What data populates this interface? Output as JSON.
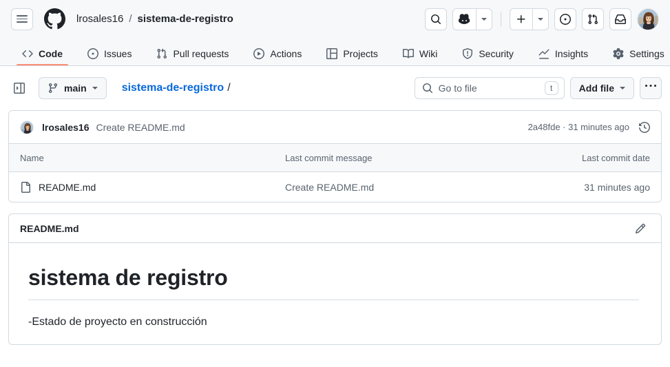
{
  "header": {
    "hamburger_icon": "hamburger-menu-icon",
    "logo_icon": "github-logo-icon",
    "breadcrumb": {
      "owner": "lrosales16",
      "separator": "/",
      "repo": "sistema-de-registro"
    },
    "actions": {
      "search_icon": "search-icon",
      "copilot_icon": "copilot-icon",
      "copilot_caret_icon": "chevron-down-icon",
      "plus_icon": "plus-icon",
      "plus_caret_icon": "chevron-down-icon",
      "issues_icon": "issue-opened-icon",
      "pull_requests_icon": "git-pull-request-icon",
      "inbox_icon": "inbox-icon",
      "avatar_icon": "user-avatar"
    }
  },
  "repo_nav": {
    "tabs": [
      {
        "label": "Code",
        "icon": "code-icon",
        "active": true
      },
      {
        "label": "Issues",
        "icon": "issue-opened-icon",
        "active": false
      },
      {
        "label": "Pull requests",
        "icon": "git-pull-request-icon",
        "active": false
      },
      {
        "label": "Actions",
        "icon": "play-icon",
        "active": false
      },
      {
        "label": "Projects",
        "icon": "table-icon",
        "active": false
      },
      {
        "label": "Wiki",
        "icon": "book-icon",
        "active": false
      },
      {
        "label": "Security",
        "icon": "shield-icon",
        "active": false
      },
      {
        "label": "Insights",
        "icon": "graph-icon",
        "active": false
      },
      {
        "label": "Settings",
        "icon": "gear-icon",
        "active": false
      }
    ],
    "active_underline_color": "#fd8c73"
  },
  "toolbar": {
    "sidebar_toggle_icon": "sidebar-expand-icon",
    "branch": {
      "icon": "git-branch-icon",
      "name": "main",
      "caret_icon": "chevron-down-icon"
    },
    "path": {
      "repo": "sistema-de-registro",
      "separator": "/"
    },
    "go_to_file": {
      "icon": "search-icon",
      "placeholder": "Go to file",
      "value": "",
      "shortcut_key": "t"
    },
    "add_file": {
      "label": "Add file",
      "caret_icon": "chevron-down-icon"
    },
    "kebab": {
      "label": "...",
      "icon": "kebab-horizontal-icon"
    }
  },
  "latest_commit": {
    "avatar_icon": "user-avatar",
    "author": "lrosales16",
    "message": "Create README.md",
    "sha": "2a48fde",
    "separator": "·",
    "relative_time": "31 minutes ago",
    "meta": "2a48fde · 31 minutes ago",
    "history_icon": "history-icon"
  },
  "file_table": {
    "columns": {
      "name": "Name",
      "message": "Last commit message",
      "date": "Last commit date"
    },
    "rows": [
      {
        "icon": "file-icon",
        "name": "README.md",
        "message": "Create README.md",
        "date": "31 minutes ago"
      }
    ]
  },
  "readme": {
    "title": "README.md",
    "edit_icon": "pencil-icon",
    "heading": "sistema de registro",
    "paragraph": "-Estado de proyecto en construcción"
  },
  "colors": {
    "accent": "#0969da",
    "active_tab": "#fd8c73",
    "header_bg": "#f6f8fa",
    "border": "#d1d9e0",
    "muted_text": "#59636e",
    "scroll_marker": "#8bc34a"
  }
}
